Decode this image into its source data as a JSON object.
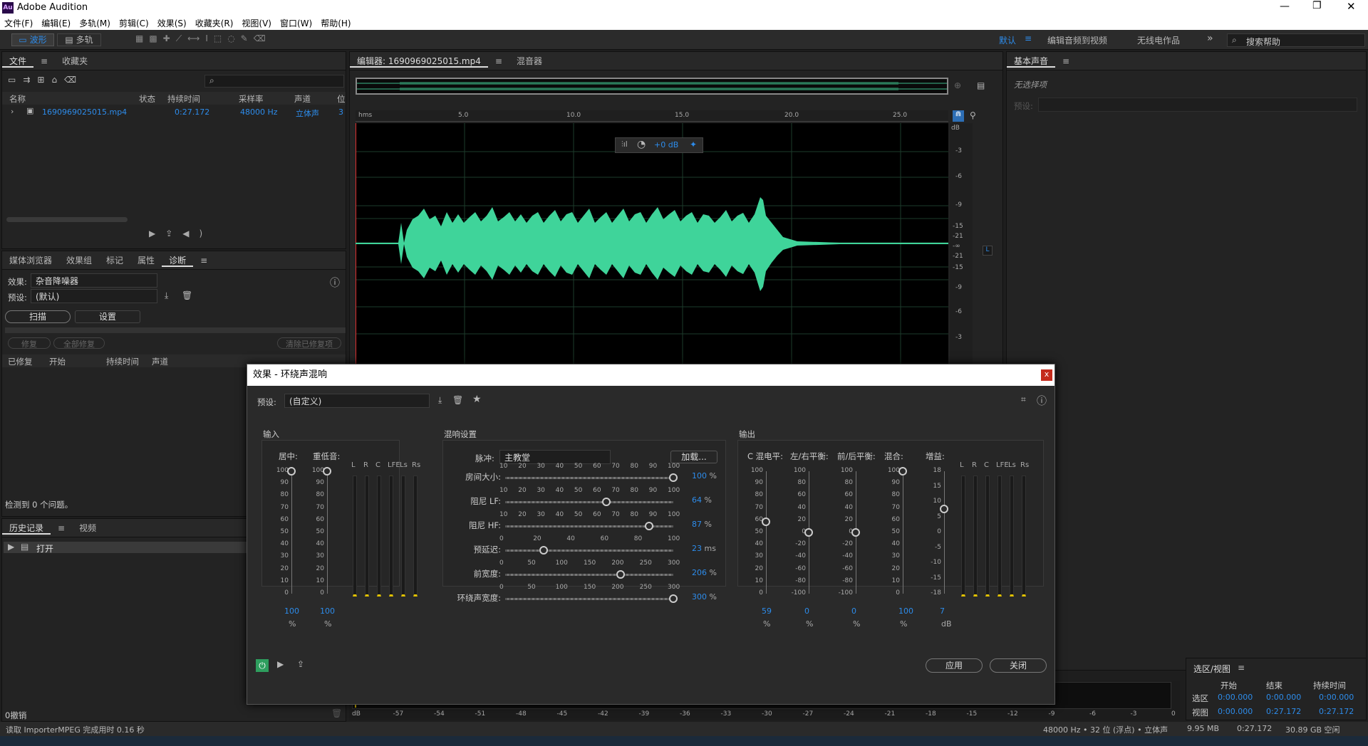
{
  "app": {
    "title": "Adobe Audition",
    "logo": "Au"
  },
  "menu": [
    "文件(F)",
    "编辑(E)",
    "多轨(M)",
    "剪辑(C)",
    "效果(S)",
    "收藏夹(R)",
    "视图(V)",
    "窗口(W)",
    "帮助(H)"
  ],
  "toolbar": {
    "waveform": "波形",
    "multitrack": "多轨",
    "workspace_default": "默认",
    "workspace_video": "编辑音频到视频",
    "workspace_radio": "无线电作品",
    "search_placeholder": "搜索帮助"
  },
  "files_panel": {
    "tabs": [
      "文件",
      "收藏夹"
    ],
    "columns": [
      "名称",
      "状态",
      "持续时间",
      "采样率",
      "声道",
      "位"
    ],
    "file": {
      "name": "1690969025015.mp4",
      "duration": "0:27.172",
      "rate": "48000 Hz",
      "channels": "立体声",
      "bits": "3"
    }
  },
  "diag_panel": {
    "tabs": [
      "媒体浏览器",
      "效果组",
      "标记",
      "属性",
      "诊断"
    ],
    "effect_label": "效果:",
    "effect_value": "杂音降噪器",
    "preset_label": "预设:",
    "preset_value": "(默认)",
    "scan": "扫描",
    "settings": "设置",
    "repair": "修复",
    "repair_all": "全部修复",
    "clear_repaired": "清除已修复项",
    "columns": [
      "已修复",
      "开始",
      "持续时间",
      "声道"
    ],
    "status": "检测到 0 个问题。"
  },
  "history_panel": {
    "tabs": [
      "历史记录",
      "视频"
    ],
    "item": "打开",
    "undo": "0撤销"
  },
  "editor": {
    "tab_editor": "编辑器: 1690969025015.mp4",
    "tab_mixer": "混音器",
    "time_unit": "hms",
    "time_ticks": [
      "5.0",
      "10.0",
      "15.0",
      "20.0",
      "25.0"
    ],
    "gain_hud": "+0 dB",
    "db_label": "dB",
    "db_ticks": [
      "-3",
      "-6",
      "-9",
      "-15",
      "-21",
      "-∞",
      "-21",
      "-15",
      "-9",
      "-6",
      "-3"
    ],
    "channel_l": "L"
  },
  "essential_sound": {
    "title": "基本声音",
    "no_selection": "无选择项",
    "preset_label": "预设:"
  },
  "level_meter": {
    "ticks": [
      "dB",
      "-57",
      "-54",
      "-51",
      "-48",
      "-45",
      "-42",
      "-39",
      "-36",
      "-33",
      "-30",
      "-27",
      "-24",
      "-21",
      "-18",
      "-15",
      "-12",
      "-9",
      "-6",
      "-3",
      "0"
    ]
  },
  "selection_view": {
    "title": "选区/视图",
    "cols": [
      "开始",
      "结束",
      "持续时间"
    ],
    "rows": [
      {
        "label": "选区",
        "start": "0:00.000",
        "end": "0:00.000",
        "dur": "0:00.000"
      },
      {
        "label": "视图",
        "start": "0:00.000",
        "end": "0:27.172",
        "dur": "0:27.172"
      }
    ]
  },
  "statusbar": {
    "left": "读取 ImporterMPEG 完成用时 0.16 秒",
    "format": "48000 Hz • 32 位 (浮点) • 立体声",
    "size": "9.95 MB",
    "dur": "0:27.172",
    "free": "30.89 GB 空闲"
  },
  "dialog": {
    "title": "效果 - 环绕声混响",
    "close": "x",
    "preset_label": "预设:",
    "preset_value": "(自定义)",
    "input": {
      "title": "输入",
      "center": "居中:",
      "lfe": "重低音:",
      "center_val": "100",
      "lfe_val": "100",
      "unit": "%",
      "meter_labels": [
        "L",
        "R",
        "C",
        "LFE",
        "Ls",
        "Rs"
      ],
      "ticks": [
        "100",
        "90",
        "80",
        "70",
        "60",
        "50",
        "40",
        "30",
        "20",
        "10",
        "0"
      ],
      "center_level": 1.0,
      "lfe_level": 1.0
    },
    "reverb": {
      "title": "混响设置",
      "impulse_label": "脉冲:",
      "impulse_value": "主教堂",
      "load": "加载...",
      "sliders": [
        {
          "label": "房间大小:",
          "value": "100",
          "unit": "%",
          "ticks": [
            "10",
            "20",
            "30",
            "40",
            "50",
            "60",
            "70",
            "80",
            "90",
            "100"
          ],
          "pos": 1.0
        },
        {
          "label": "阻尼 LF:",
          "value": "64",
          "unit": "%",
          "ticks": [
            "10",
            "20",
            "30",
            "40",
            "50",
            "60",
            "70",
            "80",
            "90",
            "100"
          ],
          "pos": 0.6
        },
        {
          "label": "阻尼 HF:",
          "value": "87",
          "unit": "%",
          "ticks": [
            "10",
            "20",
            "30",
            "40",
            "50",
            "60",
            "70",
            "80",
            "90",
            "100"
          ],
          "pos": 0.856
        },
        {
          "label": "预延迟:",
          "value": "23",
          "unit": "ms",
          "ticks": [
            "0",
            "20",
            "40",
            "60",
            "80",
            "100"
          ],
          "pos": 0.23
        },
        {
          "label": "前宽度:",
          "value": "206",
          "unit": "%",
          "ticks": [
            "0",
            "50",
            "100",
            "150",
            "200",
            "250",
            "300"
          ],
          "pos": 0.687
        },
        {
          "label": "环绕声宽度:",
          "value": "300",
          "unit": "%",
          "ticks": [
            "0",
            "50",
            "100",
            "150",
            "200",
            "250",
            "300"
          ],
          "pos": 1.0
        }
      ]
    },
    "output": {
      "title": "输出",
      "meter_labels": [
        "L",
        "R",
        "C",
        "LFE",
        "Ls",
        "Rs"
      ],
      "controls": [
        {
          "label": "C 混电平:",
          "value": "59",
          "unit": "%",
          "ticks": [
            "100",
            "90",
            "80",
            "70",
            "60",
            "50",
            "40",
            "30",
            "20",
            "10",
            "0"
          ],
          "pos": 0.59
        },
        {
          "label": "左/右平衡:",
          "value": "0",
          "unit": "%",
          "ticks": [
            "100",
            "80",
            "60",
            "40",
            "20",
            "0",
            "-20",
            "-40",
            "-60",
            "-80",
            "-100"
          ],
          "pos": 0.5
        },
        {
          "label": "前/后平衡:",
          "value": "0",
          "unit": "%",
          "ticks": [
            "100",
            "80",
            "60",
            "40",
            "20",
            "0",
            "-20",
            "-40",
            "-60",
            "-80",
            "-100"
          ],
          "pos": 0.5
        },
        {
          "label": "混合:",
          "value": "100",
          "unit": "%",
          "ticks": [
            "100",
            "90",
            "80",
            "70",
            "60",
            "50",
            "40",
            "30",
            "20",
            "10",
            "0"
          ],
          "pos": 1.0
        },
        {
          "label": "增益:",
          "value": "7",
          "unit": "dB",
          "ticks": [
            "18",
            "15",
            "10",
            "5",
            "0",
            "-5",
            "-10",
            "-15",
            "-18"
          ],
          "pos": 0.694
        }
      ]
    },
    "apply": "应用",
    "closebtn": "关闭"
  }
}
